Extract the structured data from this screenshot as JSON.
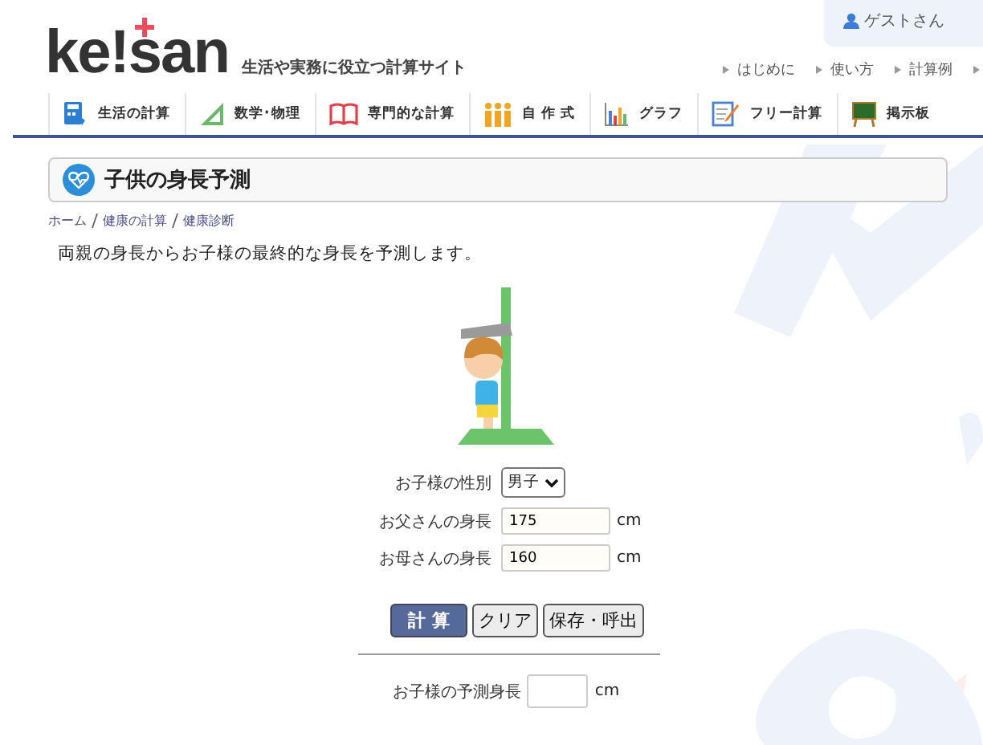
{
  "user_menu": {
    "label": "ゲストさん"
  },
  "logo": {
    "text": "ke!san",
    "tagline": "生活や実務に役立つ計算サイト"
  },
  "header_links": [
    "はじめに",
    "使い方",
    "計算例"
  ],
  "nav": [
    {
      "label": "生活の計算",
      "kind": "calculator"
    },
    {
      "label": "数学･物理",
      "kind": "ruler"
    },
    {
      "label": "専門的な計算",
      "kind": "book"
    },
    {
      "label": "自 作 式",
      "kind": "people"
    },
    {
      "label": "グラフ",
      "kind": "chart"
    },
    {
      "label": "フリー計算",
      "kind": "memo"
    },
    {
      "label": "掲示板",
      "kind": "board"
    }
  ],
  "page_title": "子供の身長予測",
  "breadcrumb": [
    "ホーム",
    "健康の計算",
    "健康診断"
  ],
  "description": "両親の身長からお子様の最終的な身長を予測します。",
  "form": {
    "rows": [
      {
        "kind": "select",
        "label": "お子様の性別",
        "value": "男子"
      },
      {
        "kind": "input",
        "label": "お父さんの身長",
        "value": "175",
        "unit": "cm"
      },
      {
        "kind": "input",
        "label": "お母さんの身長",
        "value": "160",
        "unit": "cm"
      }
    ],
    "buttons": [
      {
        "label": "計 算",
        "primary": true
      },
      {
        "label": "クリア",
        "primary": false
      },
      {
        "label": "保存・呼出",
        "primary": false
      }
    ],
    "result": {
      "label": "お子様の予測身長",
      "unit": "cm"
    }
  }
}
